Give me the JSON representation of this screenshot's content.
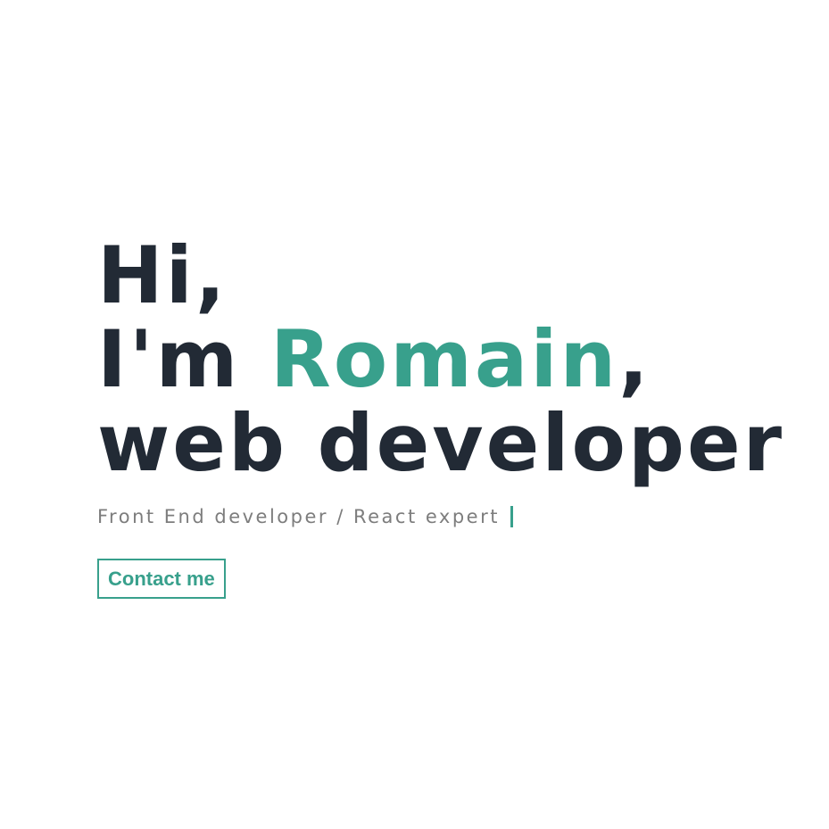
{
  "hero": {
    "greeting": "Hi,",
    "intro_prefix": "I'm ",
    "name": "Romain",
    "intro_suffix": ",",
    "role": "web developer",
    "subtitle": "Front End developer / React expert",
    "contact_label": "Contact me"
  },
  "colors": {
    "accent": "#38a08c",
    "heading": "#222a35",
    "subtitle": "#7d7d7d",
    "background": "#ffffff"
  }
}
